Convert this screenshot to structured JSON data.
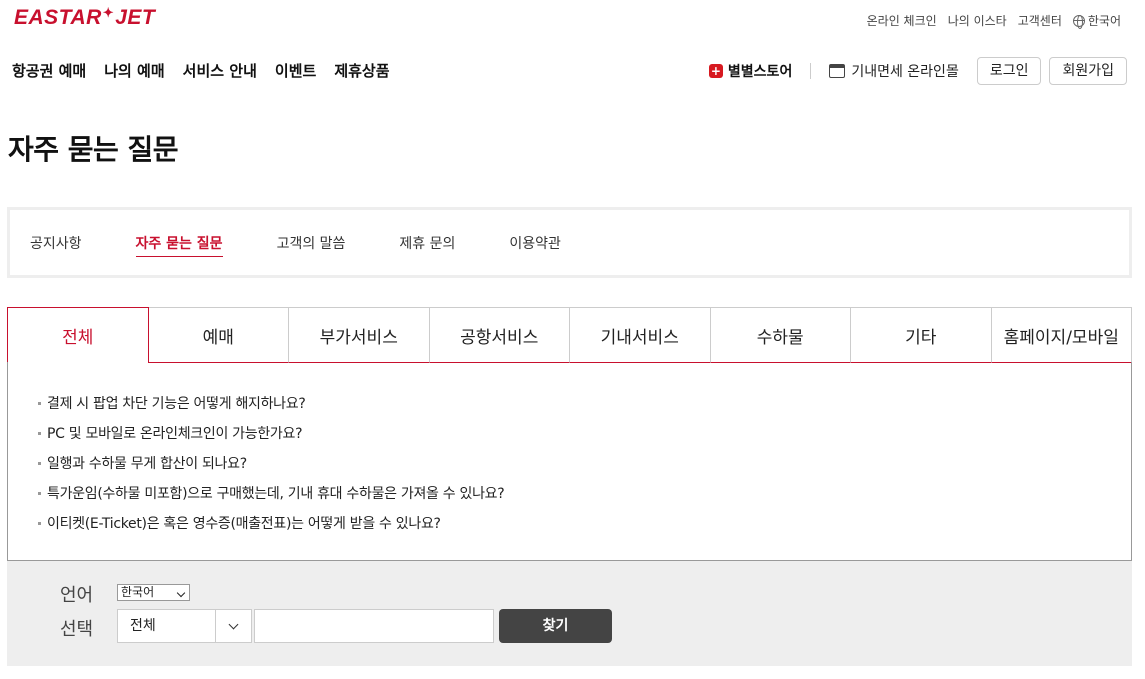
{
  "header": {
    "logo_left": "EASTAR",
    "logo_star": "✦",
    "logo_right": "JET",
    "util_links": [
      "온라인 체크인",
      "나의 이스타",
      "고객센터"
    ],
    "language": "한국어"
  },
  "main_nav": [
    "항공권 예매",
    "나의 예매",
    "서비스 안내",
    "이벤트",
    "제휴상품"
  ],
  "right_nav": {
    "store_label": "별별스토어",
    "dutyfree_label": "기내면세 온라인몰",
    "login_label": "로그인",
    "join_label": "회원가입"
  },
  "page_title": "자주 묻는 질문",
  "sub_nav": {
    "items": [
      "공지사항",
      "자주 묻는 질문",
      "고객의 말씀",
      "제휴 문의",
      "이용약관"
    ],
    "active": "자주 묻는 질문"
  },
  "category_tabs": {
    "items": [
      "전체",
      "예매",
      "부가서비스",
      "공항서비스",
      "기내서비스",
      "수하물",
      "기타",
      "홈페이지/모바일"
    ],
    "active": "전체"
  },
  "faq_items": [
    "결제 시 팝업 차단 기능은 어떻게 해지하나요?",
    "PC 및 모바일로 온라인체크인이 가능한가요?",
    "일행과 수하물 무게 합산이 되나요?",
    "특가운임(수하물 미포함)으로 구매했는데, 기내 휴대 수하물은 가져올 수 있나요?",
    "이티켓(E-Ticket)은 혹은 영수증(매출전표)는 어떻게 받을 수 있나요?"
  ],
  "search": {
    "language_label": "언어",
    "select_label": "선택",
    "language_value": "한국어",
    "category_value": "전체",
    "query_value": "",
    "button_label": "찾기"
  },
  "colors": {
    "brand": "#c8102e",
    "button_dark": "#444444",
    "panel_bg": "#eeeeee"
  }
}
